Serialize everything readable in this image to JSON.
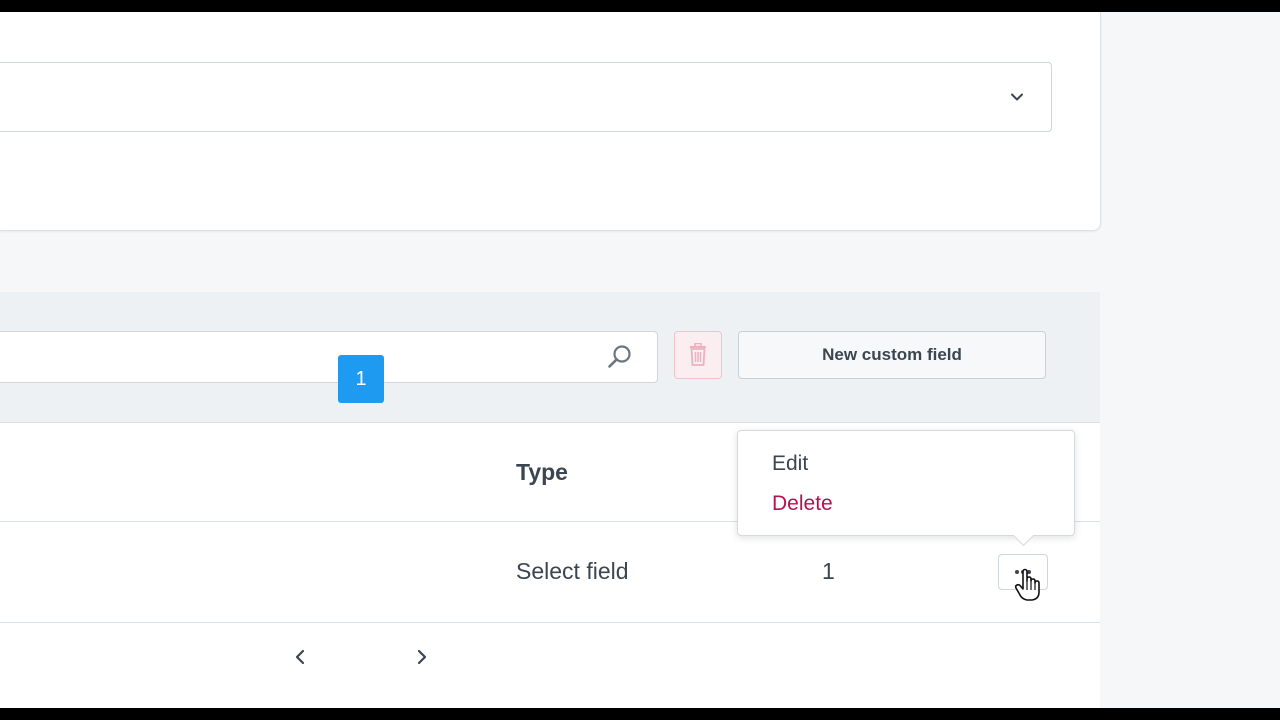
{
  "toolbar": {
    "new_button_label": "New custom field",
    "search_icon": "search-icon",
    "trash_icon": "trash-icon"
  },
  "table": {
    "headers": {
      "type": "Type"
    },
    "rows": [
      {
        "type": "Select field",
        "count": "1"
      }
    ]
  },
  "row_menu": {
    "edit_label": "Edit",
    "delete_label": "Delete"
  },
  "pagination": {
    "current_page": "1"
  },
  "colors": {
    "accent": "#1e9bf0",
    "danger": "#b3134d",
    "background": "#f5f7f8"
  }
}
